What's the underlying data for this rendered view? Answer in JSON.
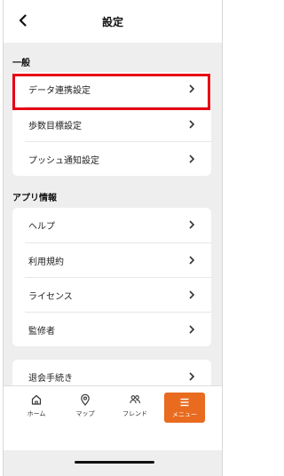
{
  "header": {
    "title": "設定"
  },
  "sections": [
    {
      "label": "一般",
      "items": [
        "データ連携設定",
        "歩数目標設定",
        "プッシュ通知設定"
      ]
    },
    {
      "label": "アプリ情報",
      "items": [
        "ヘルプ",
        "利用規約",
        "ライセンス",
        "監修者"
      ]
    },
    {
      "label": "",
      "items": [
        "退会手続き"
      ]
    }
  ],
  "tabbar": {
    "tabs": [
      {
        "label": "ホーム",
        "icon": "home-icon"
      },
      {
        "label": "マップ",
        "icon": "map-pin-icon"
      },
      {
        "label": "フレンド",
        "icon": "friends-icon"
      },
      {
        "label": "メニュー",
        "icon": "menu-icon"
      }
    ],
    "active_index": 3
  },
  "colors": {
    "accent": "#e86b1f",
    "highlight": "#e60012",
    "background": "#eeeeee"
  }
}
